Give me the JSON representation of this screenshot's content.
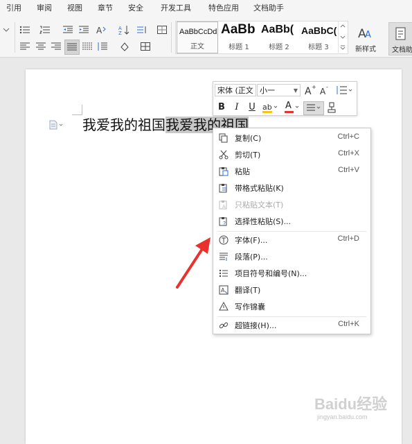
{
  "menu_tabs": [
    "引用",
    "审阅",
    "视图",
    "章节",
    "安全",
    "开发工具",
    "特色应用",
    "文档助手"
  ],
  "style_gallery": {
    "tiles": [
      {
        "sample": "AaBbCcDd",
        "caption": "正文"
      },
      {
        "sample": "AaBb",
        "caption": "标题 1"
      },
      {
        "sample": "AaBb(",
        "caption": "标题 2"
      },
      {
        "sample": "AaBbC(",
        "caption": "标题 3"
      }
    ],
    "new_style_label": "新样式",
    "doc_assist_label": "文档助"
  },
  "document": {
    "text_plain": "我爱我的祖国",
    "text_selected": "我爱我的祖国"
  },
  "mini_toolbar": {
    "font_name": "宋体 (正文",
    "font_size": "小一",
    "bold": "B",
    "italic": "I",
    "underline": "U",
    "font_color": "A"
  },
  "context_menu": {
    "items": [
      {
        "label": "复制(C)",
        "shortcut": "Ctrl+C",
        "icon": "copy-icon",
        "enabled": true
      },
      {
        "label": "剪切(T)",
        "shortcut": "Ctrl+X",
        "icon": "scissors-icon",
        "enabled": true
      },
      {
        "label": "粘贴",
        "shortcut": "Ctrl+V",
        "icon": "paste-icon",
        "enabled": true
      },
      {
        "label": "带格式粘贴(K)",
        "shortcut": "",
        "icon": "paste-format-icon",
        "enabled": true
      },
      {
        "label": "只粘贴文本(T)",
        "shortcut": "",
        "icon": "paste-text-icon",
        "enabled": false
      },
      {
        "label": "选择性粘贴(S)...",
        "shortcut": "",
        "icon": "paste-special-icon",
        "enabled": true
      },
      {
        "label": "字体(F)...",
        "shortcut": "Ctrl+D",
        "icon": "font-icon",
        "enabled": true
      },
      {
        "label": "段落(P)...",
        "shortcut": "",
        "icon": "paragraph-icon",
        "enabled": true
      },
      {
        "label": "项目符号和编号(N)...",
        "shortcut": "",
        "icon": "bullets-icon",
        "enabled": true
      },
      {
        "label": "翻译(T)",
        "shortcut": "",
        "icon": "translate-icon",
        "enabled": true
      },
      {
        "label": "写作锦囊",
        "shortcut": "",
        "icon": "writing-icon",
        "enabled": true
      },
      {
        "label": "超链接(H)...",
        "shortcut": "Ctrl+K",
        "icon": "link-icon",
        "enabled": true
      }
    ]
  },
  "watermark": {
    "brand": "Baidu经验",
    "url": "jingyan.baidu.com"
  },
  "colors": {
    "accent_red": "#e8322d",
    "selection": "#c8c8c8",
    "highlight": "#f5c518"
  }
}
